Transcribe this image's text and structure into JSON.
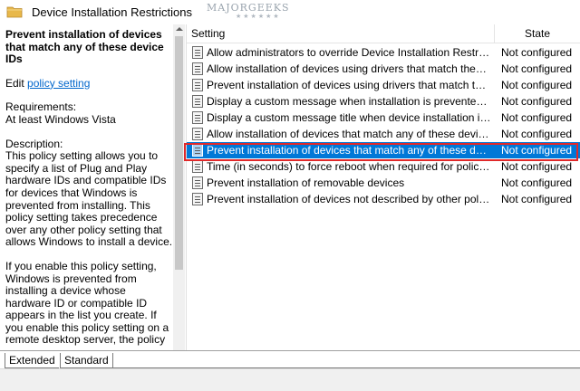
{
  "header": {
    "title": "Device Installation Restrictions",
    "watermark": "MAJORGEEKS",
    "watermark_stars": "★★★★★★"
  },
  "description": {
    "title": "Prevent installation of devices that match any of these device IDs",
    "edit_prefix": "Edit",
    "edit_link": "policy setting",
    "requirements_label": "Requirements:",
    "requirements_value": "At least Windows Vista",
    "description_label": "Description:",
    "paragraph1": "This policy setting allows you to specify a list of Plug and Play hardware IDs and compatible IDs for devices that Windows is prevented from installing. This policy setting takes precedence over any other policy setting that allows Windows to install a device.",
    "paragraph2": "If you enable this policy setting, Windows is prevented from installing a device whose hardware ID or compatible ID appears in the list you create. If you enable this policy setting on a remote desktop server, the policy"
  },
  "columns": {
    "setting": "Setting",
    "state": "State"
  },
  "rows": [
    {
      "name": "Allow administrators to override Device Installation Restricti...",
      "state": "Not configured"
    },
    {
      "name": "Allow installation of devices using drivers that match these ...",
      "state": "Not configured"
    },
    {
      "name": "Prevent installation of devices using drivers that match thes...",
      "state": "Not configured"
    },
    {
      "name": "Display a custom message when installation is prevented by...",
      "state": "Not configured"
    },
    {
      "name": "Display a custom message title when device installation is pr...",
      "state": "Not configured"
    },
    {
      "name": "Allow installation of devices that match any of these device ...",
      "state": "Not configured"
    },
    {
      "name": "Prevent installation of devices that match any of these devic...",
      "state": "Not configured"
    },
    {
      "name": "Time (in seconds) to force reboot when required for policy c...",
      "state": "Not configured"
    },
    {
      "name": "Prevent installation of removable devices",
      "state": "Not configured"
    },
    {
      "name": "Prevent installation of devices not described by other policy ...",
      "state": "Not configured"
    }
  ],
  "selected_row_index": 6,
  "tabs": {
    "extended": "Extended",
    "standard": "Standard"
  },
  "colors": {
    "selection": "#0078d7",
    "highlight_border": "#e0292a",
    "link": "#0066cc",
    "folder": "#e8b84a"
  },
  "icons": {
    "folder": "folder-icon",
    "policy": "policy-setting-icon",
    "scroll_up": "scroll-up-arrow-icon"
  }
}
